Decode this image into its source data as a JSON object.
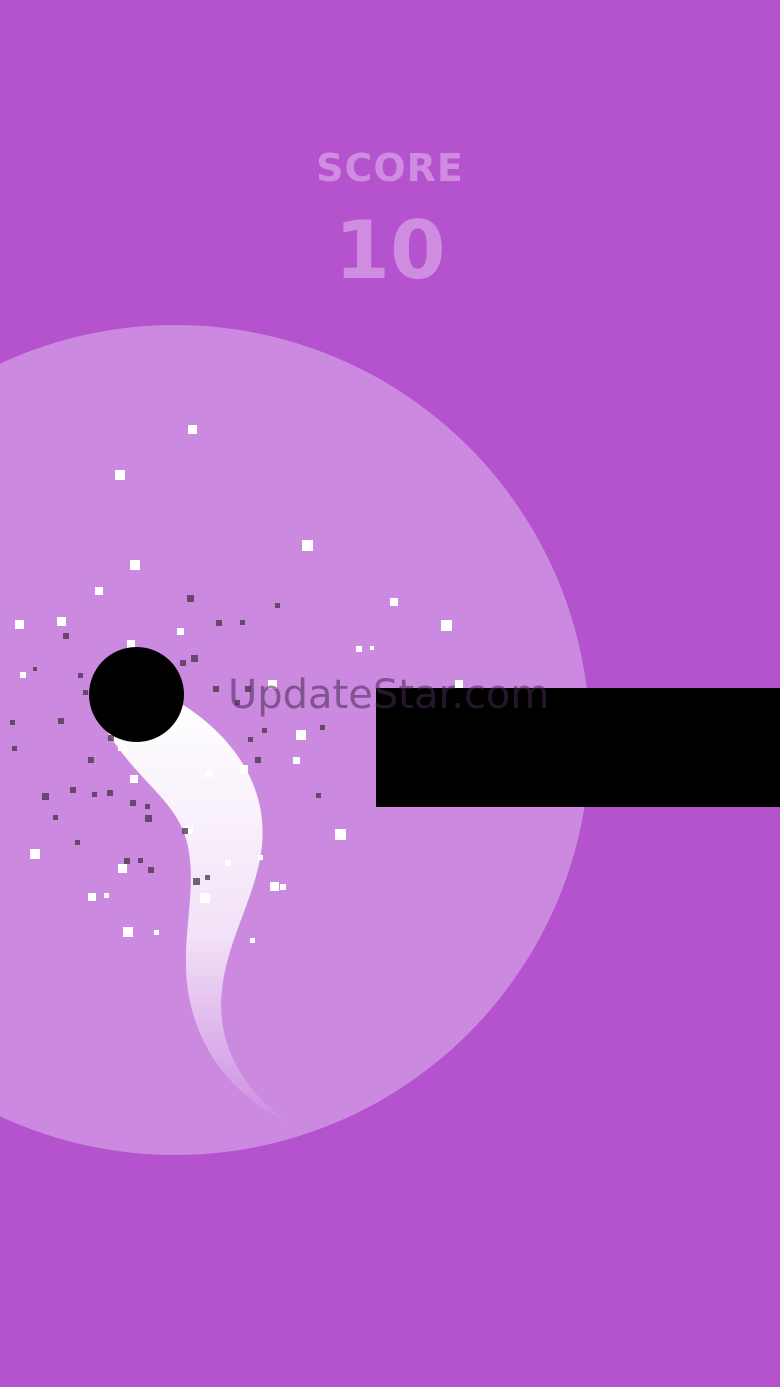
{
  "hud": {
    "score_label": "SCORE",
    "score_value": "10"
  },
  "watermark": {
    "text": "UpdateStar.com"
  },
  "colors": {
    "background": "#b552ce",
    "field_circle": "#cb8ae0",
    "score_text": "#cf8ce0",
    "player": "#000000",
    "obstacle": "#000000",
    "trail": "#ffffff"
  }
}
